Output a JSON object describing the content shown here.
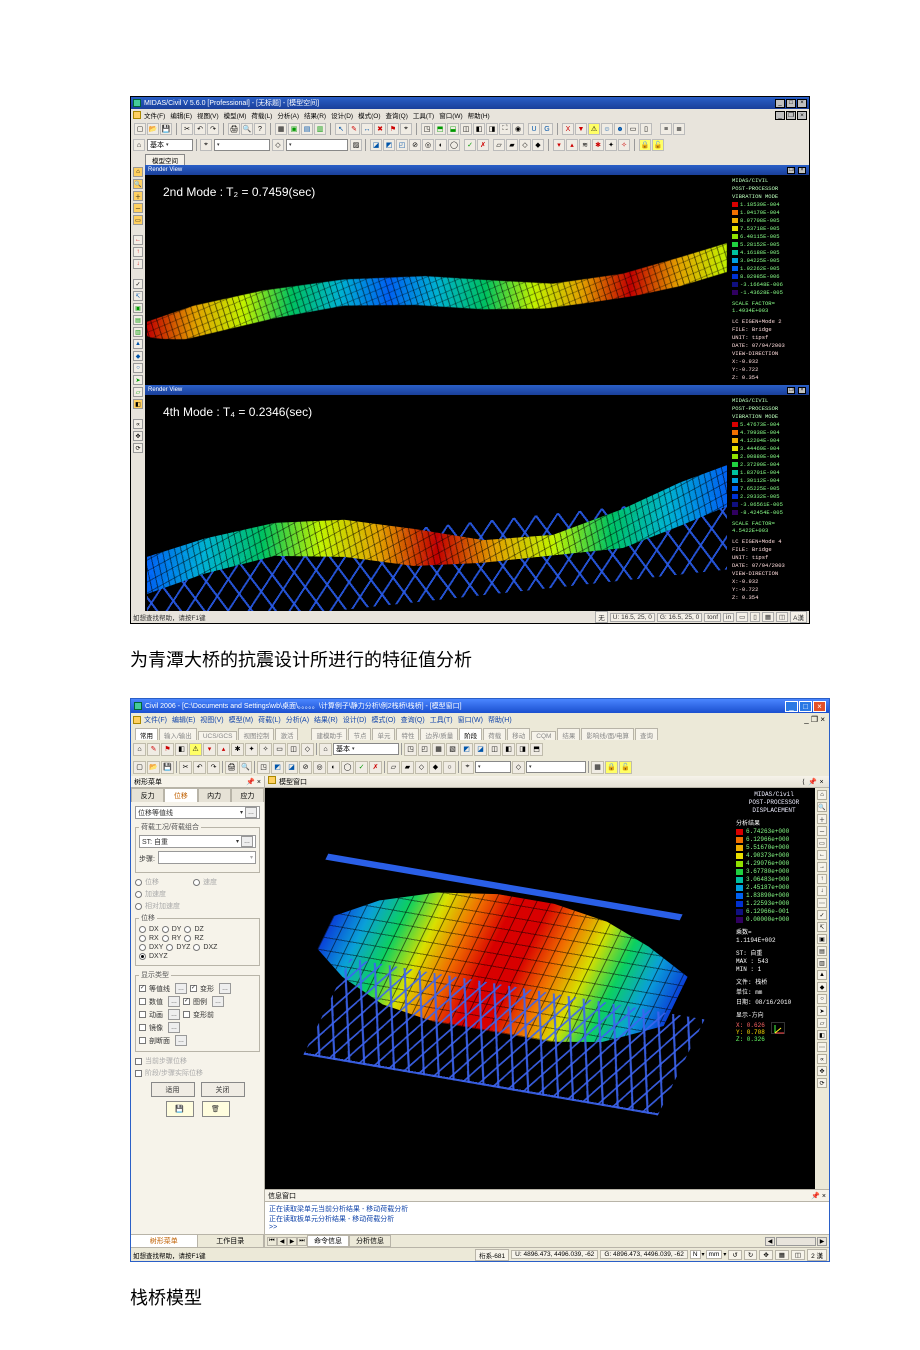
{
  "app1": {
    "title": "MIDAS/Civil V 5.6.0 [Professional] - [无标题] - [模型空间]",
    "menu": [
      "文件(F)",
      "编辑(E)",
      "视图(V)",
      "模型(M)",
      "荷载(L)",
      "分析(A)",
      "结果(R)",
      "设计(D)",
      "模式(O)",
      "查询(Q)",
      "工具(T)",
      "窗口(W)",
      "帮助(H)"
    ],
    "combo_basic": "基本",
    "tab": "模型空间",
    "render_view": "Render View",
    "mode_a": "2nd Mode : T₂ = 0.7459(sec)",
    "mode_b": "4th Mode : T₄ = 0.2346(sec)",
    "legend_header": "MIDAS/CIVIL",
    "legend_sub1": "POST-PROCESSOR",
    "legend_sub2": "VIBRATION MODE",
    "legend_vals_a": [
      "1.18539E-004",
      "1.04170E-004",
      "8.97708E-005",
      "7.53718E-005",
      "6.40115E-005",
      "5.28152E-005",
      "4.16188E-005",
      "3.04225E-005",
      "1.92262E-005",
      "8.02985E-006",
      "-3.16648E-006",
      "-1.43628E-005"
    ],
    "scale_label": "SCALE FACTOR=",
    "scale_a": "1.4934E+003",
    "lc_a": "LC EIGEN+Mode 2",
    "file_label": "FILE:",
    "file_val": "Bridge",
    "unit_label": "UNIT:",
    "unit_val": "tipsf",
    "date_label": "DATE:",
    "date_val": "07/04/2003",
    "view_dir": "VIEW-DIRECTION",
    "x_a": "X:-0.932",
    "y_a": "Y:-0.722",
    "z_a": "Z: 0.354",
    "legend_vals_b": [
      "5.47673E-004",
      "4.79938E-004",
      "4.12204E-004",
      "3.44469E-004",
      "2.90880E-004",
      "2.37290E-004",
      "1.83701E-004",
      "1.30112E-004",
      "7.65225E-005",
      "2.29332E-005",
      "-3.06561E-005",
      "-8.42454E-005"
    ],
    "scale_b": "4.5422E+003",
    "lc_b": "LC EIGEN+Mode 4",
    "x_b": "X:-0.932",
    "y_b": "Y:-0.722",
    "z_b": "Z: 0.354",
    "status_help": "如想查找帮助，请按F1键",
    "status_none": "无",
    "status_u": "U: 16.5, 25, 0",
    "status_g": "G: 16.5, 25, 0",
    "status_unit": "tonf",
    "status_units2": "in",
    "status_extra": "A漢"
  },
  "caption1": "为青潭大桥的抗震设计所进行的特征值分析",
  "app2": {
    "title": "Civil 2006 - [C:\\Documents and Settings\\wb\\桌面\\。。。。。\\计算例子\\静力分析\\例2栈桥\\栈桥] - [模型窗口]",
    "menu": [
      "文件(F)",
      "编辑(E)",
      "视图(V)",
      "模型(M)",
      "荷载(L)",
      "分析(A)",
      "结果(R)",
      "设计(D)",
      "模式(O)",
      "查询(Q)",
      "工具(T)",
      "窗口(W)",
      "帮助(H)"
    ],
    "strip_left": [
      "常用",
      "输入/输出",
      "UCS/GCS",
      "视图控制",
      "激活"
    ],
    "strip_right": [
      "建模助手",
      "节点",
      "单元",
      "特性",
      "边界/质量",
      "阶段",
      "荷载",
      "移动",
      "CQM",
      "结果",
      "影响线/面/电算",
      "查询"
    ],
    "strip_active": "阶段",
    "combo_basic": "基本",
    "left_title": "树形菜单",
    "left_tabs": [
      "反力",
      "位移",
      "内力",
      "应力"
    ],
    "left_active_tab": "位移",
    "disp_combo": "位移等值线",
    "group_loadcase": "荷载工况/荷载组合",
    "lc_label": "ST: 自重",
    "step_label": "步骤:",
    "opt_disp": "位移",
    "opt_speed": "速度",
    "opt_accel": "加速度",
    "opt_relaccel": "相对加速度",
    "group_disp": "位移",
    "axes": [
      "DX",
      "DY",
      "DZ",
      "RX",
      "RY",
      "RZ",
      "DXY",
      "DYZ",
      "DXZ",
      "DXYZ"
    ],
    "axes_selected": "DXYZ",
    "group_showtype": "显示类型",
    "show_opts": [
      "等值线",
      "变形",
      "数值",
      "图例",
      "动画",
      "变形前",
      "镜像",
      "剖断面"
    ],
    "show_checked": [
      "等值线",
      "变形",
      "图例"
    ],
    "chk_current": "当前步骤位移",
    "chk_stage": "阶段/步骤实际位移",
    "btn_apply": "适用",
    "btn_close": "关闭",
    "bottom_tabs": [
      "树形菜单",
      "工作目录"
    ],
    "center_title": "模型窗口",
    "rpanel": {
      "hdr1": "MIDAS/Civil",
      "hdr2": "POST-PROCESSOR",
      "hdr3": "DISPLACEMENT",
      "sect_result": "分析结果",
      "vals": [
        "6.74263e+000",
        "6.12966e+000",
        "5.51670e+000",
        "4.90373e+000",
        "4.29076e+000",
        "3.67780e+000",
        "3.06483e+000",
        "2.45187e+000",
        "1.83890e+000",
        "1.22593e+000",
        "6.12966e-001",
        "0.00000e+000"
      ],
      "multiplier_label": "乘数=",
      "multiplier": "1.1194E+002",
      "st": "ST: 自重",
      "max": "MAX : 543",
      "min": "MIN : 1",
      "file_label": "文件: 栈桥",
      "unit_label": "单位: mm",
      "date_label": "日期: 08/16/2010",
      "dir_label": "显示-方向",
      "x": "X: 0.626",
      "y": "Y: 0.708",
      "z": "Z: 0.326"
    },
    "msg_title": "信息窗口",
    "msg_lines": [
      "正在读取梁单元当前分析结果 - 移动荷载分析",
      "正在读取板单元分析结果 - 移动荷载分析"
    ],
    "msg_prompt": ">>",
    "msg_tabs": [
      "命令信息",
      "分析信息"
    ],
    "status_help": "如想查找帮助，请按F1键",
    "status_frame": "桁系-681",
    "status_u": "U: 4896.473, 4496.039, -62",
    "status_g": "G: 4896.473, 4496.039, -62",
    "status_units": [
      "N",
      "mm"
    ],
    "status_ime": "2 漢"
  },
  "caption2": "栈桥模型"
}
